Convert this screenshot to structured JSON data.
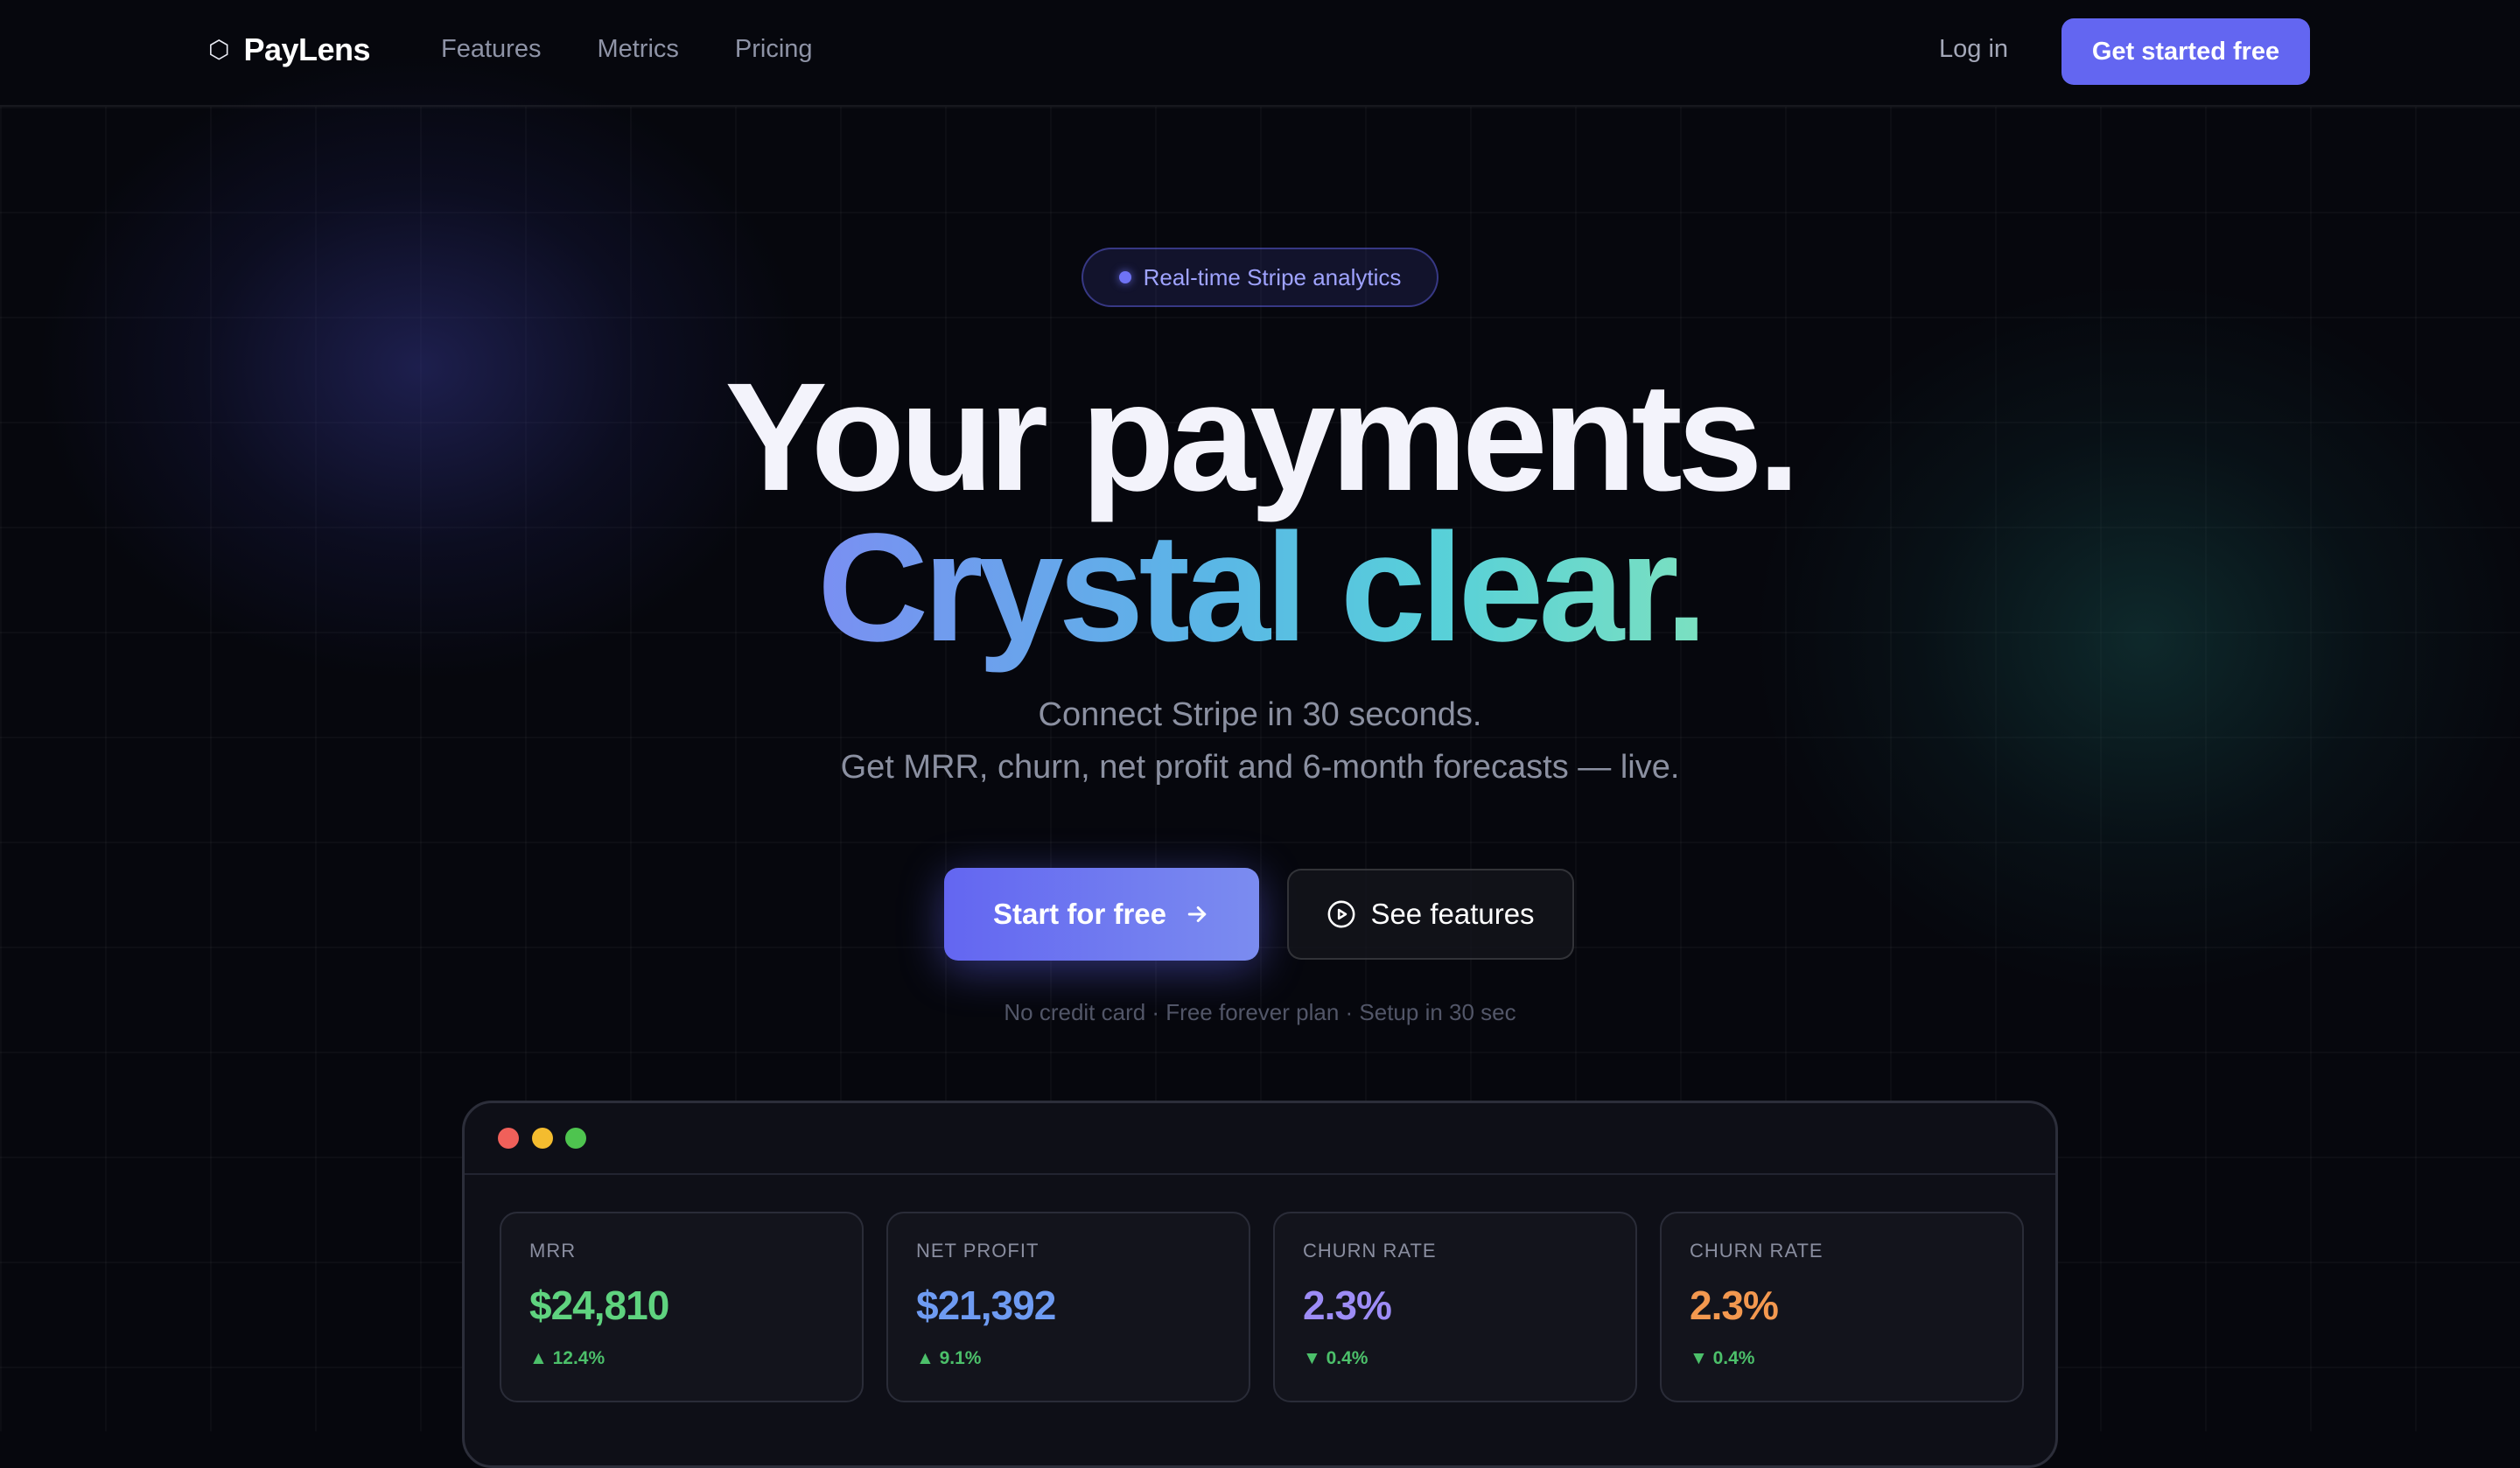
{
  "nav": {
    "logo_icon": "⬡",
    "logo_text": "PayLens",
    "links": [
      "Features",
      "Metrics",
      "Pricing"
    ],
    "login": "Log in",
    "cta": "Get started free"
  },
  "hero": {
    "badge": "Real-time Stripe analytics",
    "headline_1": "Your payments.",
    "headline_2": "Crystal clear.",
    "sub_1": "Connect Stripe in 30 seconds.",
    "sub_2": "Get MRR, churn, net profit and 6-month forecasts — live.",
    "primary_cta": "Start for free",
    "secondary_cta": "See features",
    "note": "No credit card · Free forever plan · Setup in 30 sec"
  },
  "dashboard": {
    "cards": [
      {
        "label": "MRR",
        "value": "$24,810",
        "delta": "▲ 12.4%",
        "color": "#5fd37f"
      },
      {
        "label": "NET PROFIT",
        "value": "$21,392",
        "delta": "▲ 9.1%",
        "color": "#6e9bf2"
      },
      {
        "label": "CHURN RATE",
        "value": "2.3%",
        "delta": "▼ 0.4%",
        "color": "#9d8cf6"
      },
      {
        "label": "CHURN RATE",
        "value": "2.3%",
        "delta": "▼ 0.4%",
        "color": "#f3984f"
      }
    ]
  },
  "colors": {
    "accent": "#6366f1",
    "background": "#06070d"
  }
}
